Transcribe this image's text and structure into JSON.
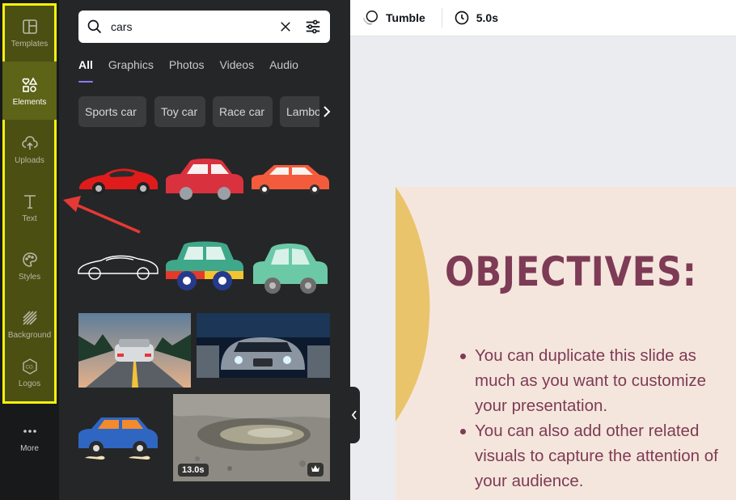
{
  "rail": {
    "items": [
      {
        "label": "Templates",
        "icon": "templates-icon"
      },
      {
        "label": "Elements",
        "icon": "elements-icon"
      },
      {
        "label": "Uploads",
        "icon": "uploads-icon"
      },
      {
        "label": "Text",
        "icon": "text-icon"
      },
      {
        "label": "Styles",
        "icon": "styles-icon"
      },
      {
        "label": "Background",
        "icon": "background-icon"
      },
      {
        "label": "Logos",
        "icon": "logos-icon"
      }
    ],
    "more_label": "More",
    "active": "Elements",
    "highlight_color": "#f5f20c"
  },
  "panel": {
    "search": {
      "value": "cars"
    },
    "tabs": [
      "All",
      "Graphics",
      "Photos",
      "Videos",
      "Audio"
    ],
    "active_tab": "All",
    "chips": [
      "Sports car",
      "Toy car",
      "Race car",
      "Lambo"
    ],
    "results": {
      "video_duration": "13.0s"
    }
  },
  "toolbar": {
    "animation_label": "Tumble",
    "duration_label": "5.0s"
  },
  "slide": {
    "title": "OBJECTIVES:",
    "bullets": [
      "You can duplicate this slide as much as you want to customize your presentation.",
      "You can also add other related visuals to capture the attention of your audience."
    ],
    "background_color": "#f5e6dd",
    "accent_color": "#e9c46a",
    "text_color": "#7e3b55"
  },
  "annotation": {
    "color": "#e53935"
  }
}
